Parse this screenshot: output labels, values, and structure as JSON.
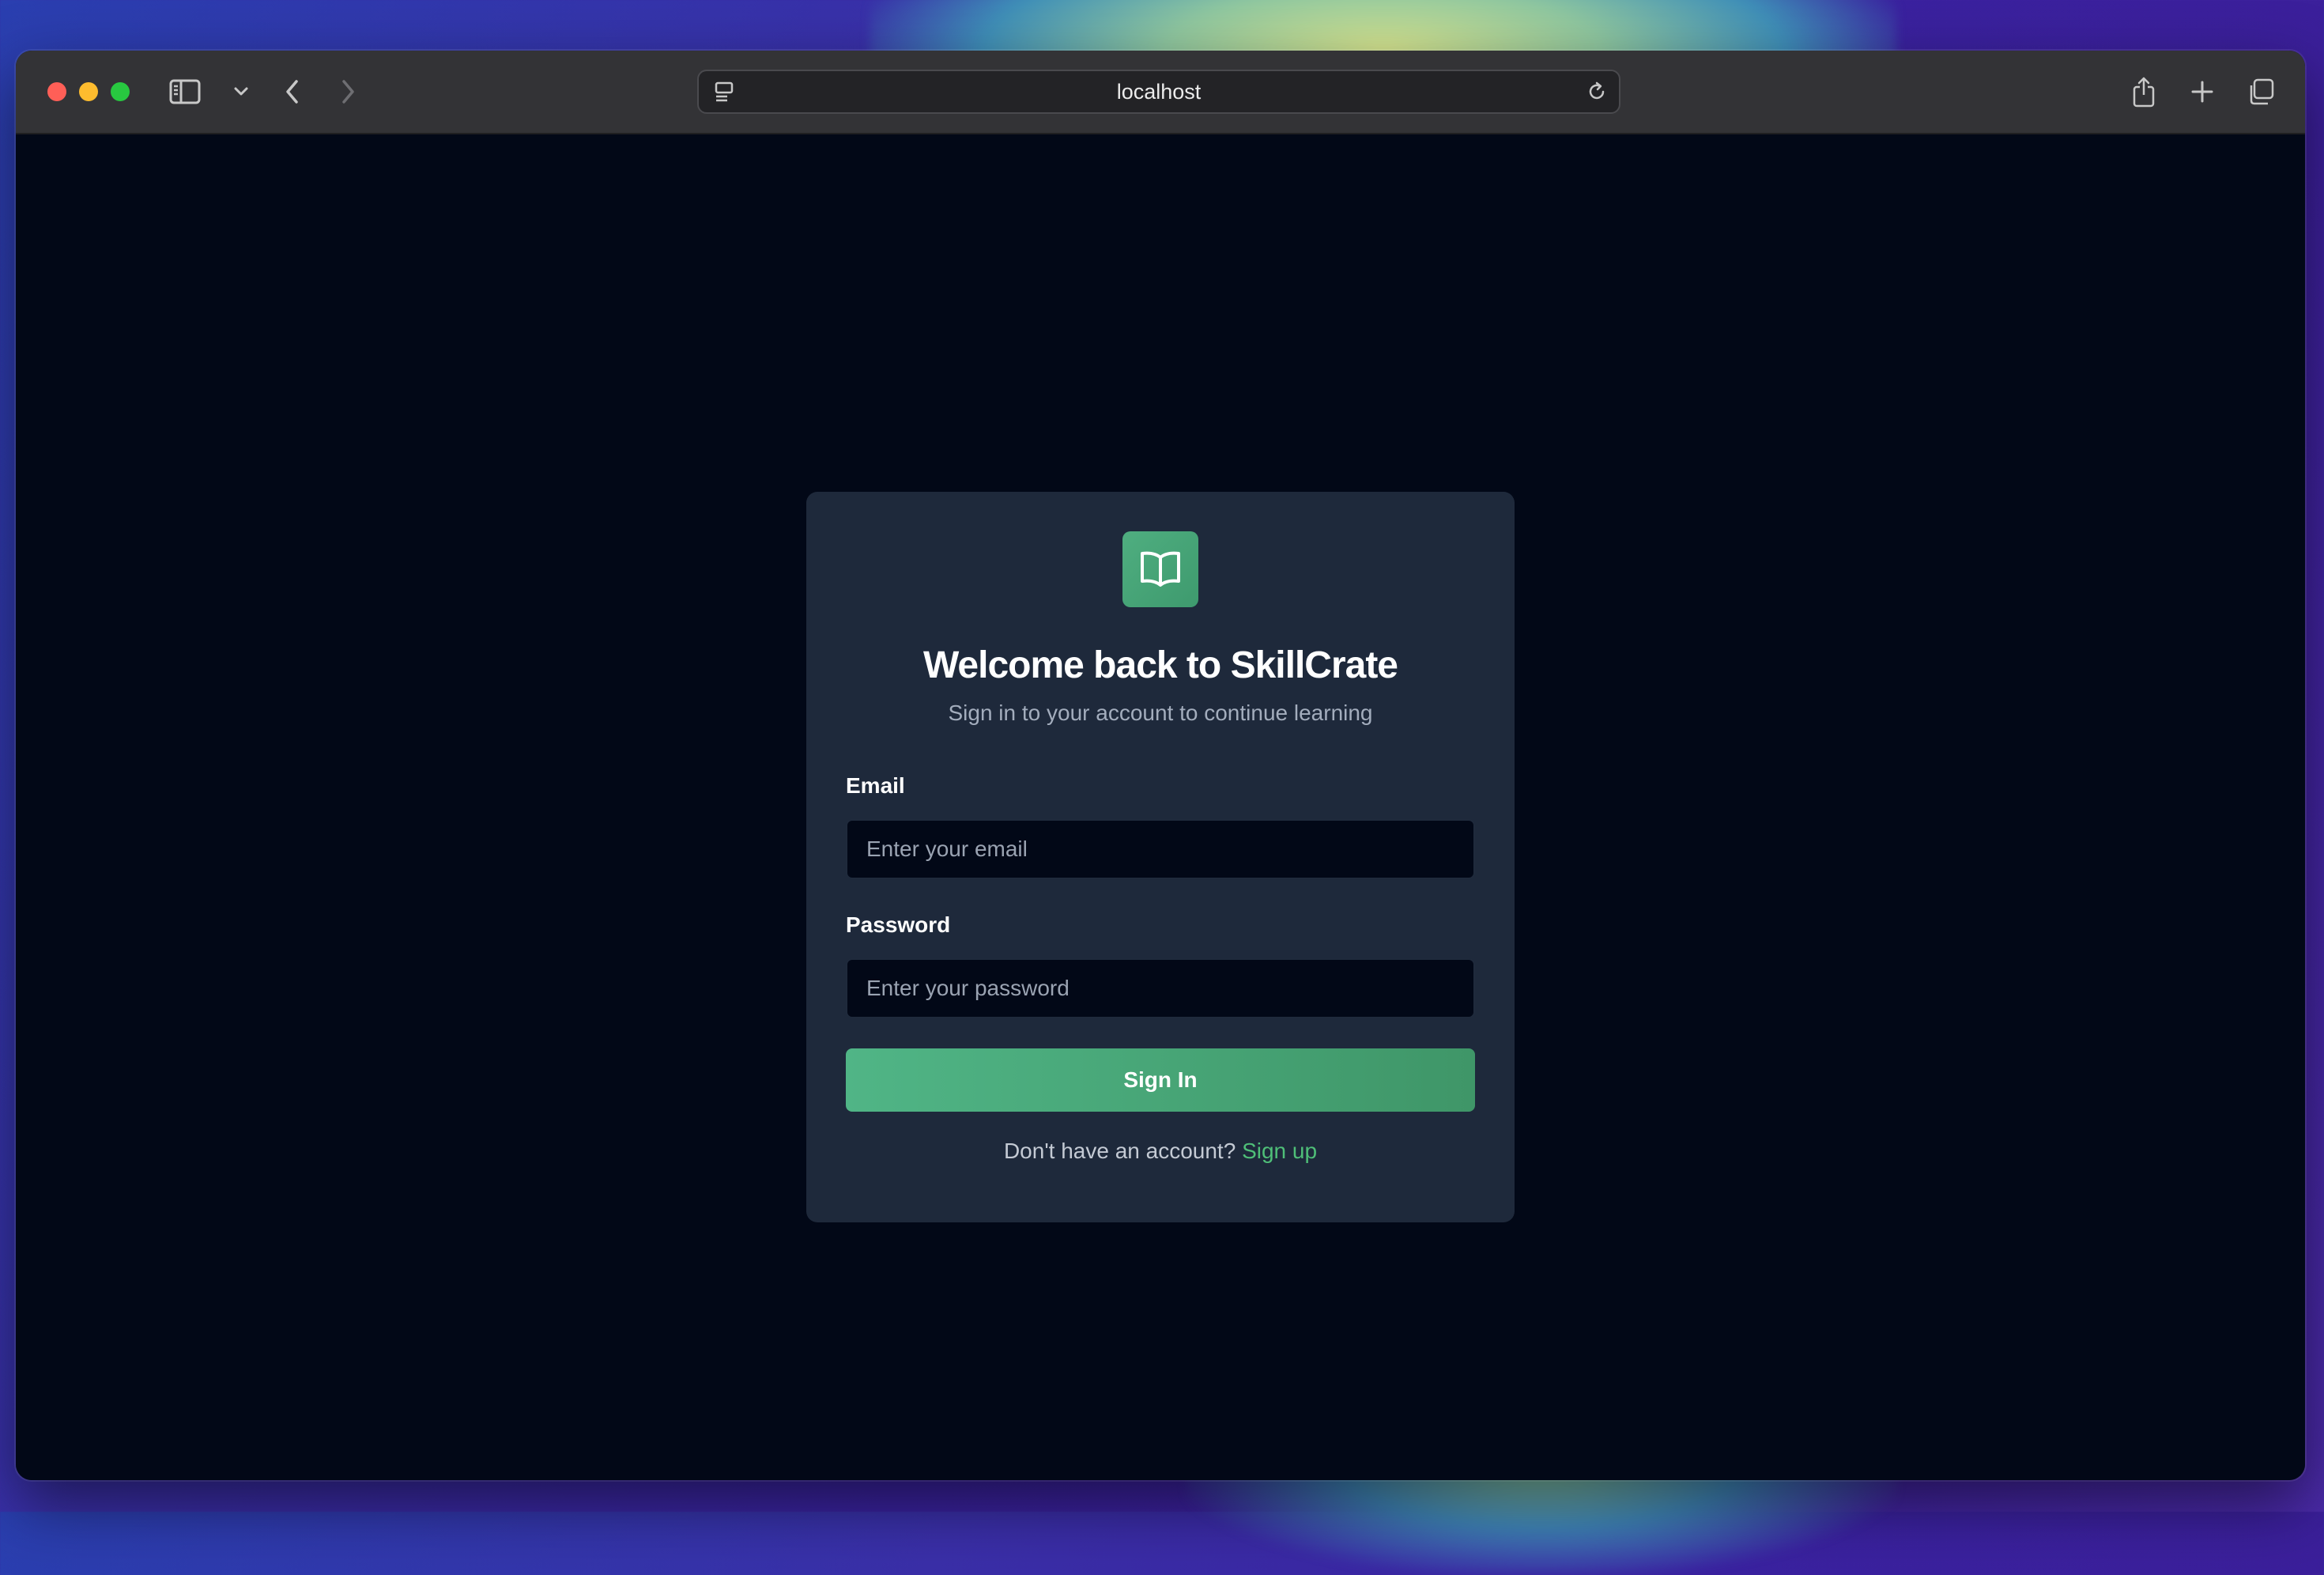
{
  "browser": {
    "url": "localhost",
    "icons": {
      "sidebar": "sidebar-icon",
      "tab_group_menu": "chevron-down-icon",
      "back": "chevron-left-icon",
      "forward": "chevron-right-icon",
      "page_menu": "page-menu-icon",
      "reload": "reload-icon",
      "share": "share-icon",
      "new_tab": "plus-icon",
      "tab_overview": "tabs-icon"
    }
  },
  "login": {
    "logo_icon": "open-book-icon",
    "title": "Welcome back to SkillCrate",
    "subtitle": "Sign in to your account to continue learning",
    "email_label": "Email",
    "email_placeholder": "Enter your email",
    "email_value": "",
    "password_label": "Password",
    "password_placeholder": "Enter your password",
    "password_value": "",
    "submit_label": "Sign In",
    "footer_text": "Don't have an account?",
    "signup_link": "Sign up"
  },
  "colors": {
    "page_background": "#020817",
    "card_background": "#1e293b",
    "accent_green": "#4fae80",
    "link_green": "#4fbf78"
  }
}
